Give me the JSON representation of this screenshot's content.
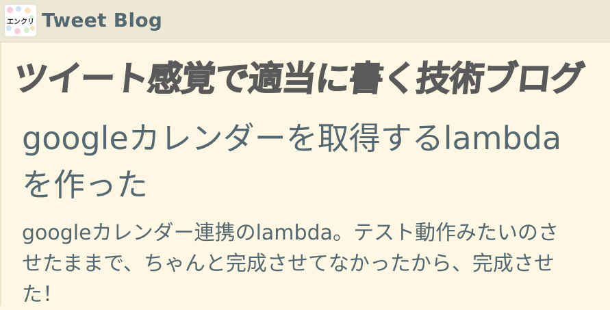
{
  "header": {
    "logo_text": "エンクリ",
    "site_name": "Tweet Blog"
  },
  "hero": {
    "headline": "ツイート感覚で適当に書く技術ブログ"
  },
  "post": {
    "title": "googleカレンダーを取得するlambdaを作った",
    "summary": "googleカレンダー連携のlambda。テスト動作みたいのさせたままで、ちゃんと完成させてなかったから、完成させた！"
  },
  "colors": {
    "page_background": "#fdf7e4",
    "header_background": "#ede8d5",
    "text": "#536870",
    "headline": "#5a5a5a"
  }
}
